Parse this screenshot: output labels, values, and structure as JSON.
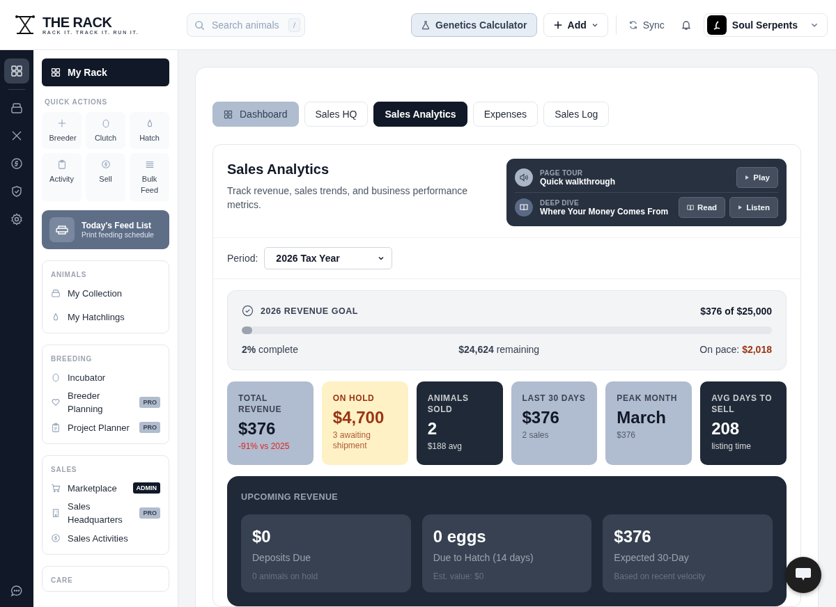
{
  "header": {
    "brand": "THE RACK",
    "tagline": "RACK IT. TRACK IT. RUN IT.",
    "search": {
      "placeholder": "Search animals",
      "shortcut": "/"
    },
    "buttons": [
      {
        "label": "Genetics Calculator",
        "kind": "highlight"
      },
      {
        "label": "Add",
        "kind": "menu"
      },
      {
        "label": "Sync",
        "kind": "plain"
      }
    ],
    "account": "Soul Serpents"
  },
  "rail": [
    {
      "selected": true
    },
    {
      "selected": false
    },
    {
      "selected": false
    },
    {
      "selected": false
    },
    {
      "selected": false
    },
    {
      "selected": false
    }
  ],
  "sidebar": {
    "home": "My Rack",
    "quick_actions_title": "QUICK ACTIONS",
    "quick_actions": [
      "Breeder",
      "Clutch",
      "Hatch",
      "Activity",
      "Sell",
      "Bulk Feed"
    ],
    "feed": {
      "title": "Today's Feed List",
      "subtitle": "Print feeding schedule"
    },
    "sections": [
      {
        "title": "ANIMALS",
        "items": [
          {
            "label": "My Collection"
          },
          {
            "label": "My Hatchlings"
          }
        ]
      },
      {
        "title": "BREEDING",
        "items": [
          {
            "label": "Incubator"
          },
          {
            "label": "Breeder Planning",
            "badge": {
              "text": "PRO",
              "kind": "pro"
            }
          },
          {
            "label": "Project Planner",
            "badge": {
              "text": "PRO",
              "kind": "pro"
            }
          }
        ]
      },
      {
        "title": "SALES",
        "items": [
          {
            "label": "Marketplace",
            "badge": {
              "text": "ADMIN",
              "kind": "admin"
            }
          },
          {
            "label": "Sales Headquarters",
            "badge": {
              "text": "PRO",
              "kind": "pro"
            }
          },
          {
            "label": "Sales Activities"
          }
        ]
      },
      {
        "title": "CARE"
      }
    ]
  },
  "tabs": [
    {
      "label": "Dashboard",
      "kind": "dashboard",
      "selected": false
    },
    {
      "label": "Sales HQ",
      "kind": "tab",
      "selected": false
    },
    {
      "label": "Sales Analytics",
      "kind": "tab",
      "selected": true
    },
    {
      "label": "Expenses",
      "kind": "tab",
      "selected": false
    },
    {
      "label": "Sales Log",
      "kind": "tab",
      "selected": false
    }
  ],
  "analytics": {
    "title": "Sales Analytics",
    "description": "Track revenue, sales trends, and business performance metrics.",
    "tour": [
      {
        "eyebrow": "PAGE TOUR",
        "title": "Quick walkthrough",
        "actions": [
          {
            "label": "Play",
            "kind": "play"
          }
        ]
      },
      {
        "eyebrow": "DEEP DIVE",
        "title": "Where Your Money Comes From",
        "actions": [
          {
            "label": "Read",
            "kind": "read"
          },
          {
            "label": "Listen",
            "kind": "play"
          }
        ]
      }
    ]
  },
  "period": {
    "label": "Period:",
    "value": "2026 Tax Year"
  },
  "goal": {
    "title": "2026 REVENUE GOAL",
    "summary": "$376 of $25,000",
    "level": 0.015,
    "complete": "**2%** complete",
    "remaining": "**$24,624** remaining",
    "pace_label": "On pace:",
    "pace": "$2,018"
  },
  "stats": [
    {
      "label": "TOTAL REVENUE",
      "value": "$376",
      "note": "-91% vs 2025",
      "kind": "light",
      "negative": true
    },
    {
      "label": "ON HOLD",
      "value": "$4,700",
      "note": "3 awaiting shipment",
      "kind": "hold",
      "negative": false
    },
    {
      "label": "ANIMALS SOLD",
      "value": "2",
      "note": "$188 avg",
      "kind": "dark",
      "negative": false
    },
    {
      "label": "LAST 30 DAYS",
      "value": "$376",
      "note": "2 sales",
      "kind": "light",
      "negative": false
    },
    {
      "label": "PEAK MONTH",
      "value": "March",
      "note": "$376",
      "kind": "light",
      "negative": false
    },
    {
      "label": "AVG DAYS TO SELL",
      "value": "208",
      "note": "listing time",
      "kind": "dark",
      "negative": false
    }
  ],
  "upcoming": {
    "title": "UPCOMING REVENUE",
    "cards": [
      {
        "value": "$0",
        "label": "Deposits Due",
        "note": "0 animals on hold"
      },
      {
        "value": "0 eggs",
        "label": "Due to Hatch (14 days)",
        "note": "Est. value: $0"
      },
      {
        "value": "$376",
        "label": "Expected 30-Day",
        "note": "Based on recent velocity"
      }
    ]
  }
}
